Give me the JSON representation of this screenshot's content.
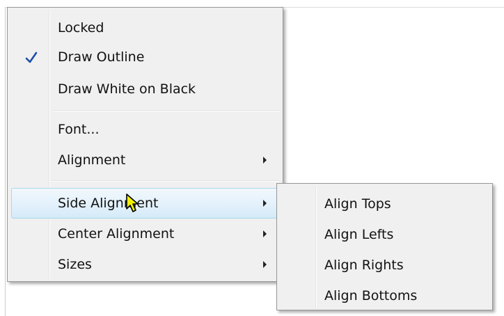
{
  "context_menu": {
    "items": [
      {
        "label": "Locked",
        "checked": false
      },
      {
        "label": "Draw Outline",
        "checked": true
      },
      {
        "label": "Draw White on Black",
        "checked": false
      },
      {
        "label": "Font...",
        "checked": false
      },
      {
        "label": "Alignment",
        "has_submenu": true
      },
      {
        "label": "Side Alignment",
        "has_submenu": true,
        "highlighted": true
      },
      {
        "label": "Center Alignment",
        "has_submenu": true
      },
      {
        "label": "Sizes",
        "has_submenu": true
      }
    ]
  },
  "submenu": {
    "parent": "Side Alignment",
    "items": [
      {
        "label": "Align Tops"
      },
      {
        "label": "Align Lefts"
      },
      {
        "label": "Align Rights"
      },
      {
        "label": "Align Bottoms"
      }
    ]
  },
  "icons": {
    "check": "checkmark-icon",
    "submenu_arrow": "chevron-right-icon",
    "cursor": "arrow-pointer-icon"
  },
  "colors": {
    "menu_background": "#f0f0f0",
    "highlight_border": "#a8d8eb",
    "highlight_fill": "#e3f1fb",
    "checkmark": "#1c4fa8",
    "cursor_fill": "#f5f000"
  }
}
